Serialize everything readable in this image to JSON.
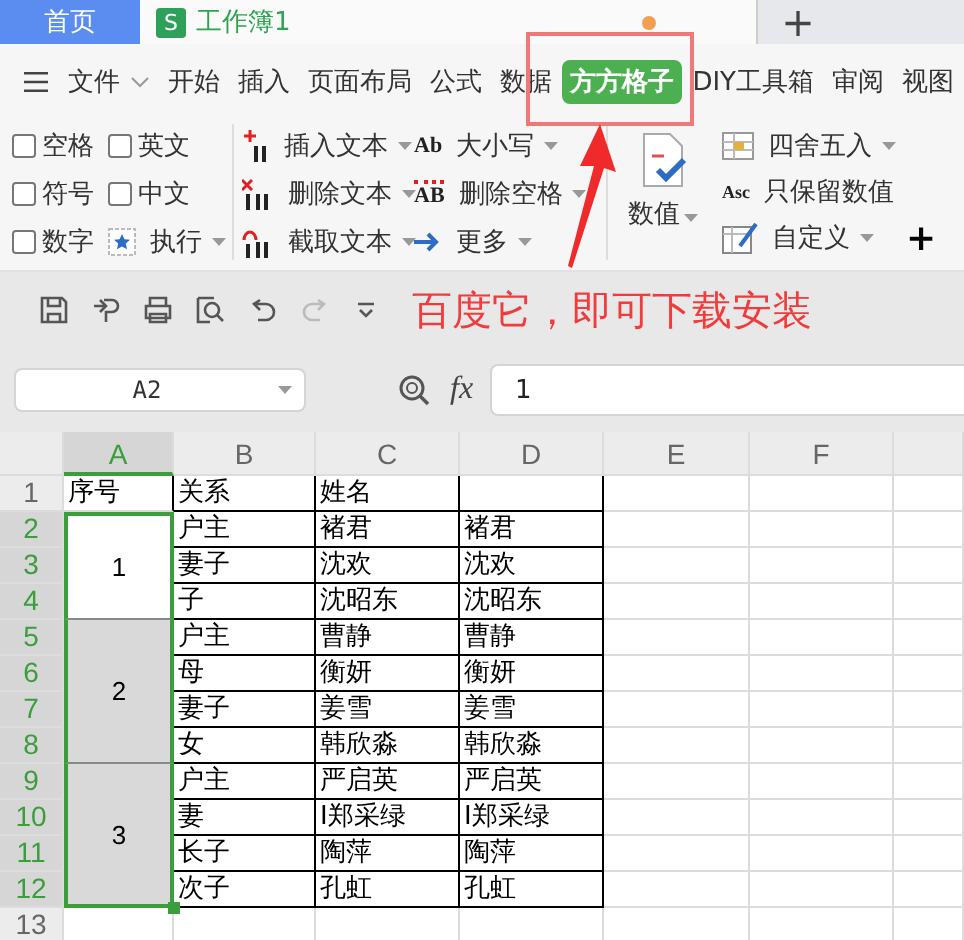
{
  "tabs": [
    {
      "kind": "home",
      "label": "首页",
      "selected": false
    },
    {
      "kind": "workbook",
      "badge": "S",
      "label": "工作簿1",
      "selected": true,
      "modified": true
    }
  ],
  "new_tab": "+",
  "menu": {
    "file": "文件",
    "items": [
      {
        "label": "开始",
        "selected": false
      },
      {
        "label": "插入",
        "selected": false
      },
      {
        "label": "页面布局",
        "selected": false
      },
      {
        "label": "公式",
        "selected": false
      },
      {
        "label": "数据",
        "selected": false
      },
      {
        "label": "方方格子",
        "selected": true
      },
      {
        "label": "DIY工具箱",
        "selected": false
      },
      {
        "label": "审阅",
        "selected": false
      },
      {
        "label": "视图",
        "selected": false
      }
    ]
  },
  "ribbon": {
    "checkboxes": [
      {
        "label": "空格",
        "checked": false
      },
      {
        "label": "英文",
        "checked": false
      },
      {
        "label": "符号",
        "checked": false
      },
      {
        "label": "中文",
        "checked": false
      },
      {
        "label": "数字",
        "checked": false
      }
    ],
    "execute": "执行",
    "text_tools": [
      {
        "kind": "insert",
        "label": "插入文本"
      },
      {
        "kind": "case",
        "icon_text": "Ab",
        "label": "大小写"
      },
      {
        "kind": "delete",
        "label": "删除文本"
      },
      {
        "kind": "trim",
        "icon_text": "AB",
        "label": "删除空格"
      },
      {
        "kind": "extract",
        "label": "截取文本"
      },
      {
        "kind": "more",
        "label": "更多"
      }
    ],
    "value_button": "数值",
    "number_tools": [
      {
        "kind": "round",
        "label": "四舍五入",
        "dropdown": true
      },
      {
        "kind": "keep",
        "icon_text": "Asc",
        "label": "只保留数值",
        "dropdown": false
      },
      {
        "kind": "custom",
        "label": "自定义",
        "dropdown": true
      }
    ],
    "add": "+"
  },
  "quick_access": [
    {
      "kind": "save",
      "disabled": false
    },
    {
      "kind": "export",
      "disabled": false
    },
    {
      "kind": "print",
      "disabled": false
    },
    {
      "kind": "preview",
      "disabled": false
    },
    {
      "kind": "undo",
      "disabled": false
    },
    {
      "kind": "redo",
      "disabled": true
    },
    {
      "kind": "customize",
      "disabled": false
    }
  ],
  "annotation": {
    "note": "百度它，即可下载安装"
  },
  "formula_bar": {
    "name_box": "A2",
    "fx": "fx",
    "value": "1"
  },
  "sheet": {
    "columns": [
      {
        "label": "A",
        "selected": true
      },
      {
        "label": "B",
        "selected": false
      },
      {
        "label": "C",
        "selected": false
      },
      {
        "label": "D",
        "selected": false
      },
      {
        "label": "E",
        "selected": false
      },
      {
        "label": "F",
        "selected": false
      }
    ],
    "header_row": {
      "number": "1",
      "selected": false,
      "cells": [
        "序号",
        "关系",
        "姓名"
      ]
    },
    "groups": [
      {
        "value": "1",
        "active": true,
        "rows": [
          {
            "number": "2",
            "selected": true,
            "cells": [
              "户主",
              "褚君",
              "褚君"
            ]
          },
          {
            "number": "3",
            "selected": true,
            "cells": [
              "妻子",
              "沈欢",
              "沈欢"
            ]
          },
          {
            "number": "4",
            "selected": true,
            "cells": [
              "子",
              "沈昭东",
              "沈昭东"
            ]
          }
        ]
      },
      {
        "value": "2",
        "active": false,
        "rows": [
          {
            "number": "5",
            "selected": true,
            "cells": [
              "户主",
              "曹静",
              "曹静"
            ]
          },
          {
            "number": "6",
            "selected": true,
            "cells": [
              "母",
              "衡妍",
              "衡妍"
            ]
          },
          {
            "number": "7",
            "selected": true,
            "cells": [
              "妻子",
              "姜雪",
              "姜雪"
            ]
          },
          {
            "number": "8",
            "selected": true,
            "cells": [
              "女",
              "韩欣淼",
              "韩欣淼"
            ]
          }
        ]
      },
      {
        "value": "3",
        "active": false,
        "rows": [
          {
            "number": "9",
            "selected": true,
            "cells": [
              "户主",
              "严启英",
              "严启英"
            ]
          },
          {
            "number": "10",
            "selected": true,
            "cells": [
              "妻",
              "I郑采绿",
              "I郑采绿"
            ]
          },
          {
            "number": "11",
            "selected": true,
            "cells": [
              "长子",
              "陶萍",
              "陶萍"
            ]
          },
          {
            "number": "12",
            "selected": true,
            "cells": [
              "次子",
              "孔虹",
              "孔虹"
            ]
          }
        ]
      }
    ],
    "trailing_row": {
      "number": "13",
      "selected": false
    }
  }
}
